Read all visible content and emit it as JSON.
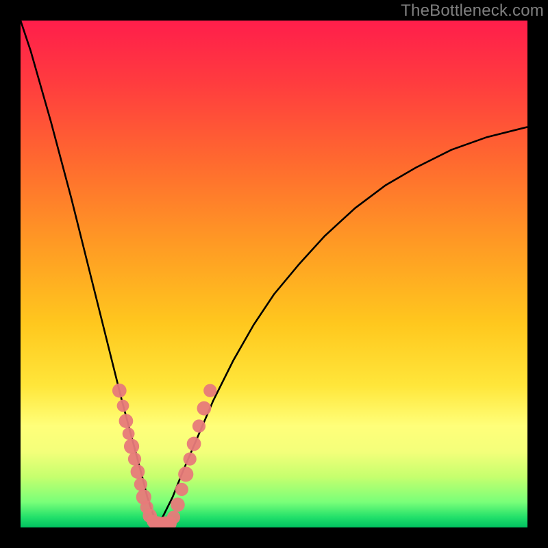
{
  "watermark": "TheBottleneck.com",
  "colors": {
    "frame": "#000000",
    "gradient_top": "#ff1e4b",
    "gradient_mid": "#ffe63a",
    "gradient_bottom": "#00c060",
    "curve": "#000000",
    "dot_fill": "#e77a7a",
    "dot_stroke": "#b24f4f"
  },
  "chart_data": {
    "type": "line",
    "title": "",
    "xlabel": "",
    "ylabel": "",
    "xlim": [
      0,
      100
    ],
    "ylim": [
      0,
      100
    ],
    "curve_min_x": 27,
    "series": [
      {
        "name": "bottleneck-curve-left",
        "x": [
          0,
          2,
          4,
          6,
          8,
          10,
          12,
          14,
          16,
          18,
          20,
          22,
          24,
          25,
          26,
          27
        ],
        "y": [
          100,
          94,
          87,
          80,
          72.5,
          65,
          57,
          49,
          41,
          33,
          25,
          17.5,
          10,
          6,
          3,
          0.5
        ]
      },
      {
        "name": "bottleneck-curve-right",
        "x": [
          27,
          28,
          30,
          32,
          35,
          38,
          42,
          46,
          50,
          55,
          60,
          66,
          72,
          78,
          85,
          92,
          100
        ],
        "y": [
          0.5,
          2,
          6,
          11,
          18,
          25,
          33,
          40,
          46,
          52,
          57.5,
          63,
          67.5,
          71,
          74.5,
          77,
          79
        ]
      }
    ],
    "scatter": {
      "name": "sample-points",
      "points": [
        {
          "x": 19.5,
          "y": 27,
          "r": 1.4
        },
        {
          "x": 20.2,
          "y": 24,
          "r": 1.2
        },
        {
          "x": 20.8,
          "y": 21,
          "r": 1.4
        },
        {
          "x": 21.3,
          "y": 18.5,
          "r": 1.2
        },
        {
          "x": 21.9,
          "y": 16,
          "r": 1.5
        },
        {
          "x": 22.5,
          "y": 13.5,
          "r": 1.3
        },
        {
          "x": 23.1,
          "y": 11,
          "r": 1.4
        },
        {
          "x": 23.7,
          "y": 8.5,
          "r": 1.3
        },
        {
          "x": 24.3,
          "y": 6,
          "r": 1.5
        },
        {
          "x": 24.9,
          "y": 4,
          "r": 1.3
        },
        {
          "x": 25.5,
          "y": 2.3,
          "r": 1.4
        },
        {
          "x": 26.2,
          "y": 1.2,
          "r": 1.3
        },
        {
          "x": 27.0,
          "y": 0.6,
          "r": 1.6
        },
        {
          "x": 27.8,
          "y": 0.6,
          "r": 1.4
        },
        {
          "x": 28.6,
          "y": 0.6,
          "r": 1.6
        },
        {
          "x": 29.4,
          "y": 0.8,
          "r": 1.4
        },
        {
          "x": 30.2,
          "y": 2.0,
          "r": 1.3
        },
        {
          "x": 31.0,
          "y": 4.5,
          "r": 1.4
        },
        {
          "x": 31.8,
          "y": 7.5,
          "r": 1.3
        },
        {
          "x": 32.6,
          "y": 10.5,
          "r": 1.5
        },
        {
          "x": 33.4,
          "y": 13.5,
          "r": 1.3
        },
        {
          "x": 34.2,
          "y": 16.5,
          "r": 1.4
        },
        {
          "x": 35.2,
          "y": 20,
          "r": 1.3
        },
        {
          "x": 36.2,
          "y": 23.5,
          "r": 1.4
        },
        {
          "x": 37.4,
          "y": 27,
          "r": 1.3
        }
      ]
    }
  }
}
